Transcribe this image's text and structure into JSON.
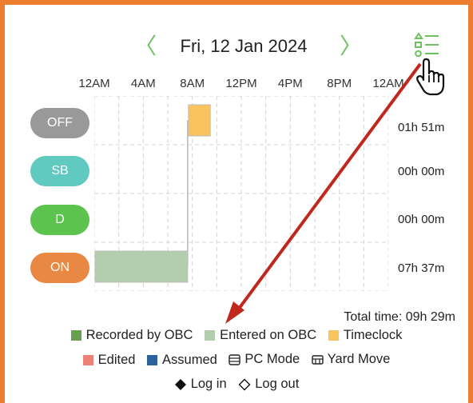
{
  "header": {
    "date": "Fri, 12 Jan 2024",
    "prev_icon": "chevron-left-icon",
    "next_icon": "chevron-right-icon",
    "filter_icon": "filter-list-icon"
  },
  "chart_data": {
    "type": "timeline",
    "x_ticks": [
      "12AM",
      "4AM",
      "8AM",
      "12PM",
      "4PM",
      "8PM",
      "12AM"
    ],
    "x_range_hours": [
      0,
      24
    ],
    "grid": true,
    "rows": [
      {
        "label": "OFF",
        "color": "#999999",
        "duration": "01h 51m"
      },
      {
        "label": "SB",
        "color": "#60c9c0",
        "duration": "00h 00m"
      },
      {
        "label": "D",
        "color": "#5bc34e",
        "duration": "00h 00m"
      },
      {
        "label": "ON",
        "color": "#e88843",
        "duration": "07h 37m"
      }
    ],
    "segments": [
      {
        "row": "ON",
        "start_hour": 0,
        "end_hour": 7.62,
        "type": "Entered on OBC",
        "color": "#b3ceac"
      },
      {
        "row": "OFF",
        "start_hour": 7.62,
        "end_hour": 9.47,
        "type": "Timeclock",
        "color": "#f9c45e"
      }
    ],
    "total_label": "Total time:",
    "total_value": "09h 29m"
  },
  "legend": [
    {
      "label": "Recorded by OBC",
      "color": "#6a9e53",
      "shape": "square"
    },
    {
      "label": "Entered on OBC",
      "color": "#b3ceac",
      "shape": "square"
    },
    {
      "label": "Timeclock",
      "color": "#f9c45e",
      "shape": "square"
    },
    {
      "label": "Edited",
      "color": "#ee8177",
      "shape": "square"
    },
    {
      "label": "Assumed",
      "color": "#2c629e",
      "shape": "square"
    },
    {
      "label": "PC Mode",
      "icon": "pc-mode-icon"
    },
    {
      "label": "Yard Move",
      "icon": "yard-move-icon"
    },
    {
      "label": "Log in",
      "icon": "filled-diamond-icon"
    },
    {
      "label": "Log out",
      "icon": "outline-diamond-icon"
    }
  ],
  "annotation": {
    "arrow_color": "#c0281e",
    "cursor_icon": "hand-pointer-icon"
  }
}
